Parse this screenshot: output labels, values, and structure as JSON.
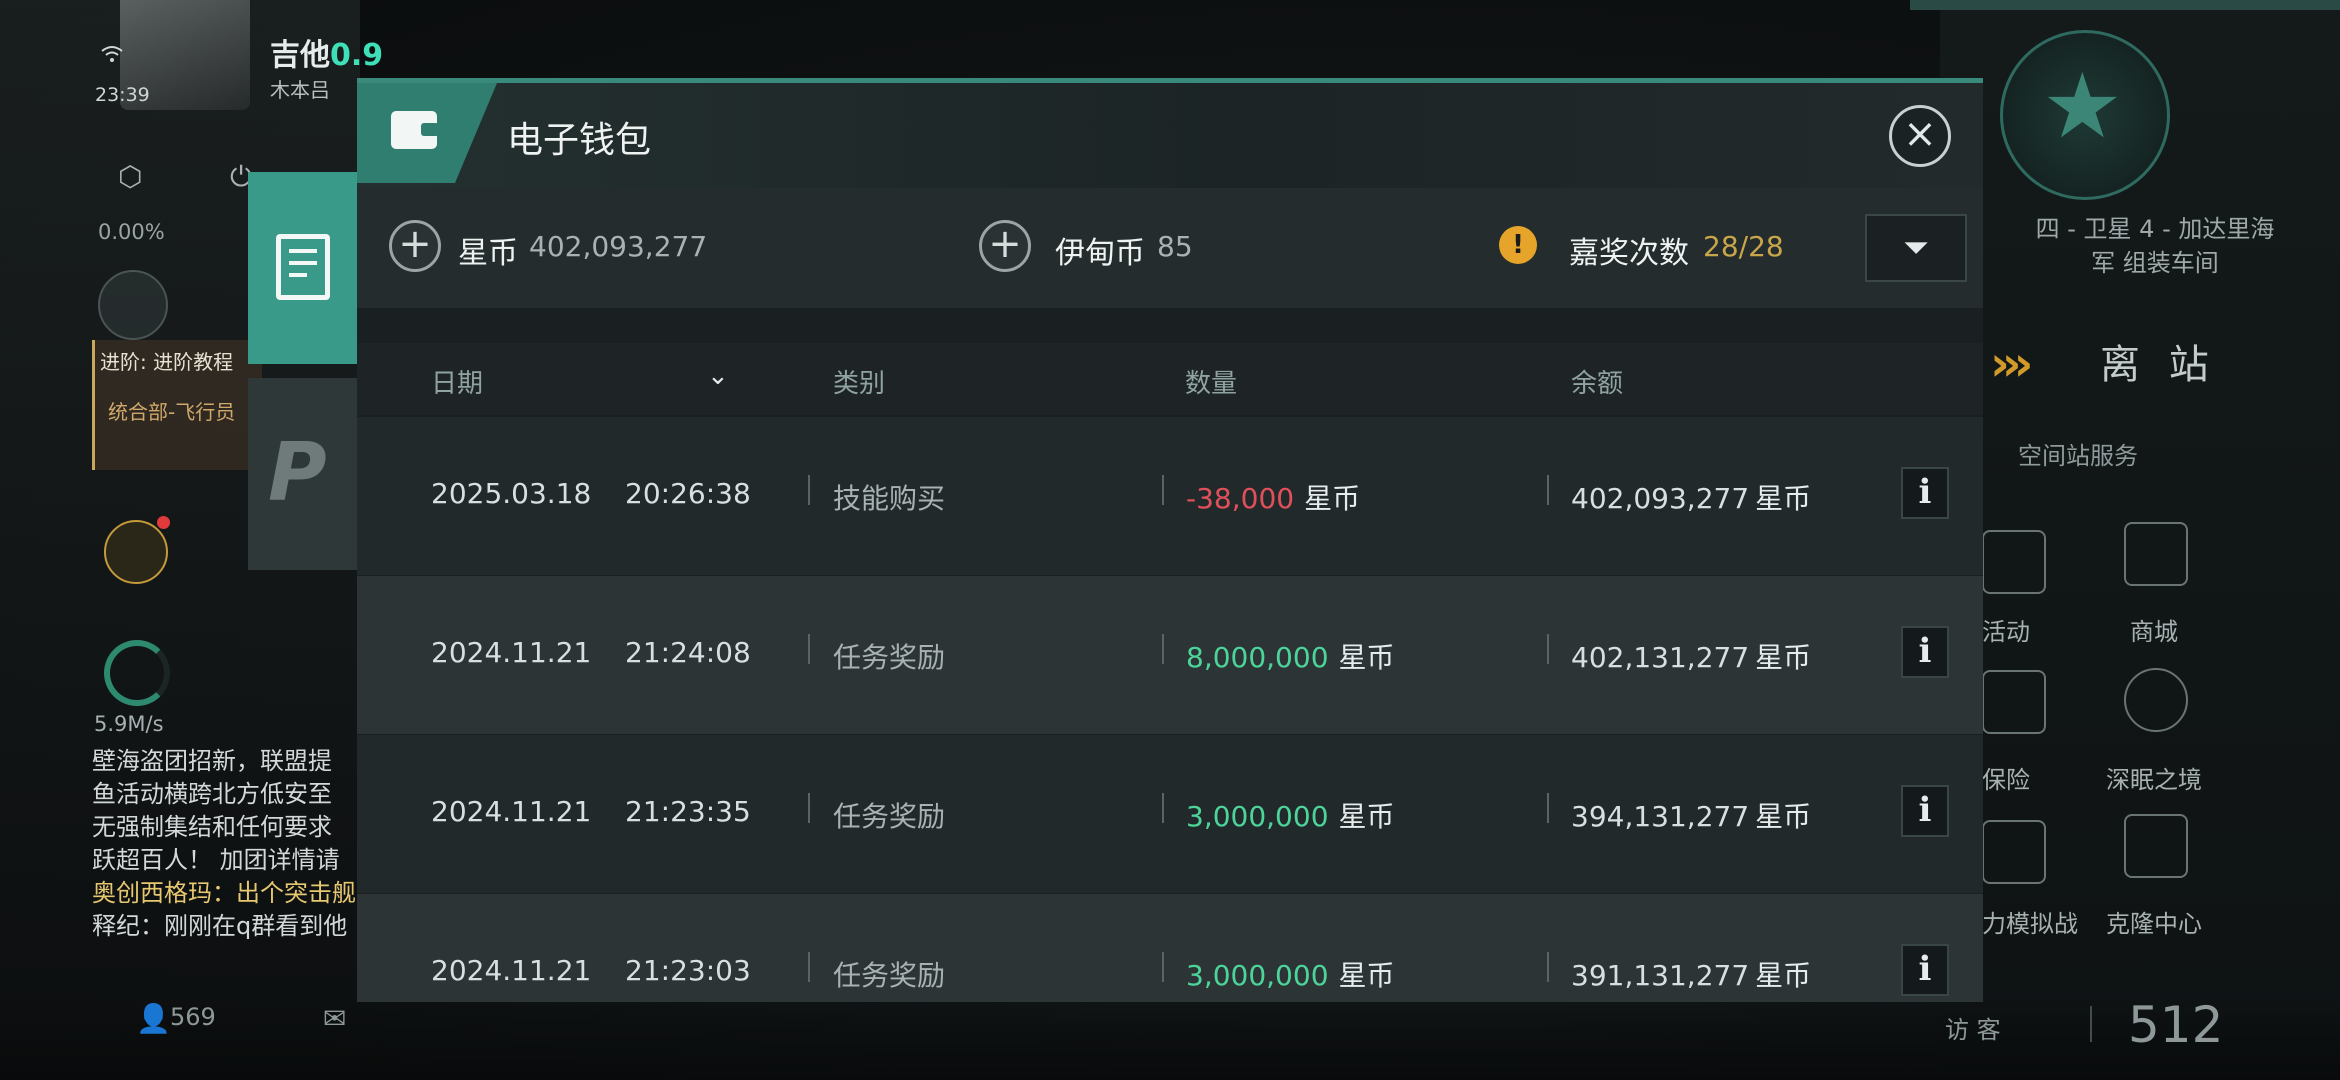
{
  "hud": {
    "clock": "23:39",
    "player_name": "吉他",
    "player_level": "0.9",
    "player_sub": "木本吕",
    "sync_percent": "0.00%",
    "tutorial_title": "进阶: 进阶教程",
    "tutorial_sub": "统合部-飞行员",
    "download_speed": "5.9M/s",
    "chat_lines": [
      {
        "text": "壁海盗团招新，联盟提",
        "highlight": false
      },
      {
        "text": "鱼活动横跨北方低安至",
        "highlight": false
      },
      {
        "text": "无强制集结和任何要求",
        "highlight": false
      },
      {
        "text": "跃超百人！ 加团详情请",
        "highlight": false
      },
      {
        "text": "奥创西格玛：出个突击舰",
        "highlight": true
      },
      {
        "text": "释纪：刚刚在q群看到他",
        "highlight": false
      }
    ],
    "online_count": "569",
    "location_line1": "四 - 卫星 4 - 加达里海",
    "location_line2": "军 组装车间",
    "undock_label": "离 站",
    "station_services_label": "空间站服务",
    "services": [
      {
        "label": "活动",
        "icon": "fireworks-icon"
      },
      {
        "label": "商城",
        "icon": "store-icon"
      },
      {
        "label": "保险",
        "icon": "insurance-icon"
      },
      {
        "label": "深眠之境",
        "icon": "deep-sleep-icon"
      },
      {
        "label": "力模拟战",
        "icon": "flags-icon"
      },
      {
        "label": "克隆中心",
        "icon": "clone-center-icon"
      }
    ],
    "visitor_label": "访 客",
    "visitor_count": "512"
  },
  "wallet": {
    "title": "电子钱包",
    "currencies": {
      "star_coin_label": "星币",
      "star_coin_value": "402,093,277",
      "isk_label": "伊甸币",
      "isk_value": "85",
      "bonus_label": "嘉奖次数",
      "bonus_value": "28/28"
    },
    "columns": {
      "date": "日期",
      "category": "类别",
      "amount": "数量",
      "balance": "余额"
    },
    "unit": "星币",
    "rows": [
      {
        "date": "2025.03.18",
        "time": "20:26:38",
        "category": "技能购买",
        "amount": "-38,000",
        "amount_sign": "negative",
        "balance": "402,093,277"
      },
      {
        "date": "2024.11.21",
        "time": "21:24:08",
        "category": "任务奖励",
        "amount": "8,000,000",
        "amount_sign": "positive",
        "balance": "402,131,277"
      },
      {
        "date": "2024.11.21",
        "time": "21:23:35",
        "category": "任务奖励",
        "amount": "3,000,000",
        "amount_sign": "positive",
        "balance": "394,131,277"
      },
      {
        "date": "2024.11.21",
        "time": "21:23:03",
        "category": "任务奖励",
        "amount": "3,000,000",
        "amount_sign": "positive",
        "balance": "391,131,277"
      }
    ],
    "colors": {
      "accent": "#3a8a7c",
      "negative": "#e0505a",
      "positive": "#4cd49a",
      "bonus": "#c8a64a"
    }
  }
}
